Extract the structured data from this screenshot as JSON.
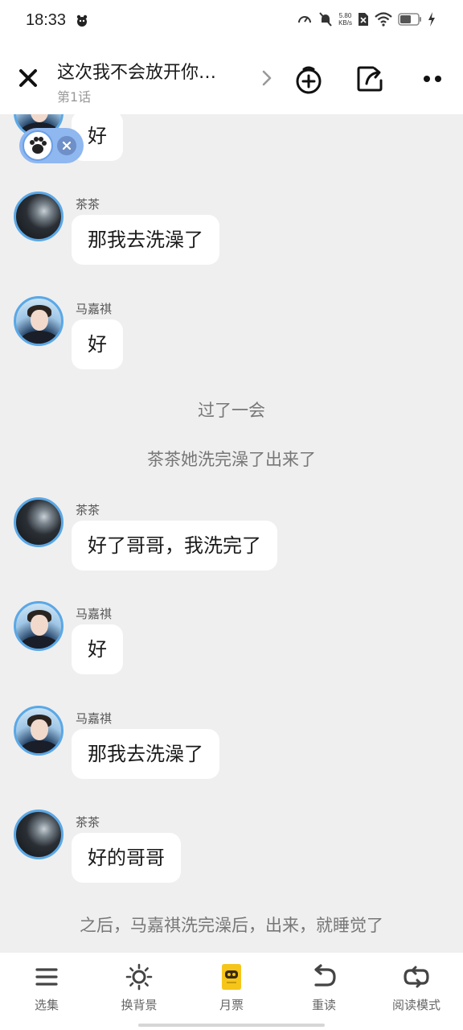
{
  "status_bar": {
    "time": "18:33",
    "net_speed_value": "5.80",
    "net_speed_unit": "KB/s",
    "battery_level": 0.6
  },
  "header": {
    "title": "这次我不会放开你…",
    "subtitle": "第1话"
  },
  "messages": [
    {
      "type": "message",
      "speaker": "",
      "text": "好",
      "avatar": "boy"
    },
    {
      "type": "message",
      "speaker": "茶茶",
      "text": "那我去洗澡了",
      "avatar": "dark"
    },
    {
      "type": "message",
      "speaker": "马嘉祺",
      "text": "好",
      "avatar": "boy"
    },
    {
      "type": "narration",
      "text": "过了一会"
    },
    {
      "type": "narration",
      "text": "茶茶她洗完澡了出来了"
    },
    {
      "type": "message",
      "speaker": "茶茶",
      "text": "好了哥哥，我洗完了",
      "avatar": "dark"
    },
    {
      "type": "message",
      "speaker": "马嘉祺",
      "text": "好",
      "avatar": "boy"
    },
    {
      "type": "message",
      "speaker": "马嘉祺",
      "text": "那我去洗澡了",
      "avatar": "boy"
    },
    {
      "type": "message",
      "speaker": "茶茶",
      "text": "好的哥哥",
      "avatar": "dark"
    },
    {
      "type": "narration",
      "text": "之后，马嘉祺洗完澡后，出来，就睡觉了"
    }
  ],
  "bottom_tabs": [
    {
      "label": "选集",
      "icon": "list-icon"
    },
    {
      "label": "换背景",
      "icon": "sun-icon"
    },
    {
      "label": "月票",
      "icon": "ticket-icon"
    },
    {
      "label": "重读",
      "icon": "undo-icon"
    },
    {
      "label": "阅读模式",
      "icon": "loop-icon"
    }
  ],
  "colors": {
    "avatar_ring": "#5aa8e6",
    "background": "#efefef",
    "ticket_yellow": "#f5c51a"
  }
}
